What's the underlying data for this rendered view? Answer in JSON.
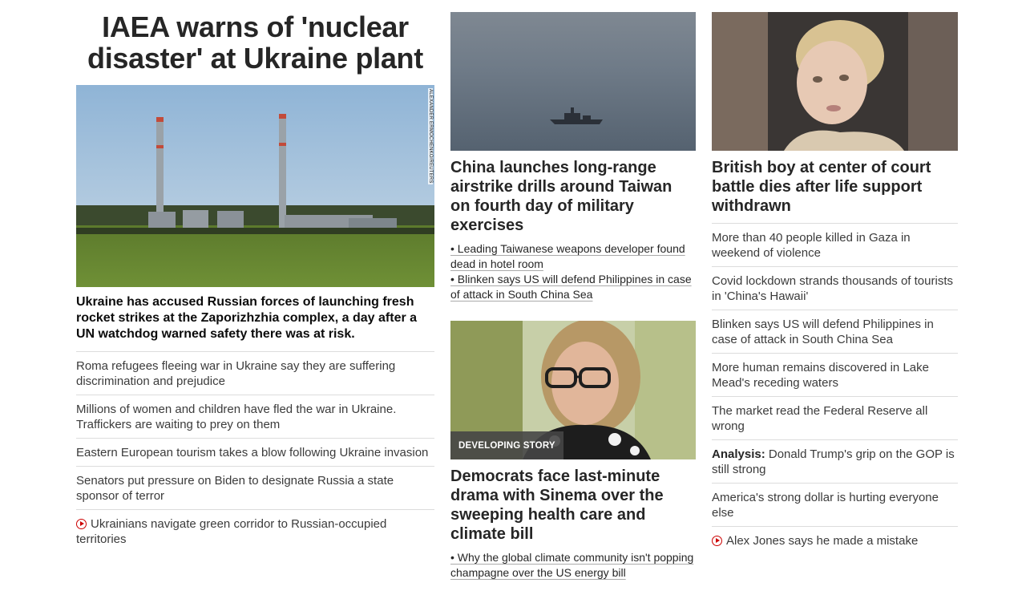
{
  "lead": {
    "title": "IAEA warns of 'nuclear disaster' at Ukraine plant",
    "image_credit": "ALEXANDER ERMOCHENKO/REUTERS",
    "summary": "Ukraine has accused Russian forces of launching fresh rocket strikes at the Zaporizhzhia complex, a day after a UN watchdog warned safety there was at risk.",
    "related": [
      "Roma refugees fleeing war in Ukraine say they are suffering discrimination and prejudice",
      "Millions of women and children have fled the war in Ukraine. Traffickers are waiting to prey on them",
      "Eastern European tourism takes a blow following Ukraine invasion",
      "Senators put pressure on Biden to designate Russia a state sponsor of terror"
    ],
    "video_item": "Ukrainians navigate green corridor to Russian-occupied territories"
  },
  "china": {
    "headline": "China launches long-range airstrike drills around Taiwan on fourth day of military exercises",
    "subs": [
      "• Leading Taiwanese weapons developer found dead in hotel room",
      "• Blinken says US will defend Philippines in case of attack in South China Sea"
    ]
  },
  "sinema": {
    "badge": "DEVELOPING STORY",
    "headline": "Democrats face last-minute drama with Sinema over the sweeping health care and climate bill",
    "subs": [
      "• Why the global climate community isn't popping champagne over the US energy bill"
    ]
  },
  "boy": {
    "headline": "British boy at center of court battle dies after life support withdrawn"
  },
  "right_list": {
    "items": [
      "More than 40 people killed in Gaza in weekend of violence",
      "Covid lockdown strands thousands of tourists in 'China's Hawaii'",
      "Blinken says US will defend Philippines in case of attack in South China Sea",
      "More human remains discovered in Lake Mead's receding waters",
      "The market read the Federal Reserve all wrong"
    ],
    "analysis_prefix": "Analysis:",
    "analysis_text": " Donald Trump's grip on the GOP is still strong",
    "item_after": "America's strong dollar is hurting everyone else",
    "video_item": "Alex Jones says he made a mistake"
  },
  "colors": {
    "video_icon": "#cc0000",
    "divider": "#dcdcdc",
    "badge_bg": "#464646"
  },
  "icons": {
    "video": "play-circle-icon"
  }
}
